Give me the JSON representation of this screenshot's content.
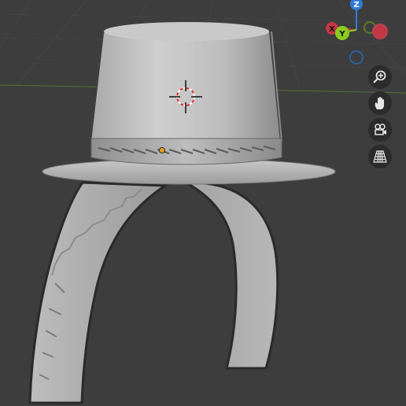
{
  "viewport": {
    "background": "#3d3d3d",
    "grid_color": "#444444",
    "horizon_color": "#5a6e3a",
    "object": "top-hat-on-arch-band"
  },
  "gizmo": {
    "z_label": "Z",
    "x_label": "X",
    "y_label": "Y",
    "colors": {
      "x": "#c33744",
      "y": "#8acb1f",
      "z": "#2f7bd7",
      "neg_x": "#b64452",
      "neg_y": "#5b7a2a",
      "neg_z": "#2f5e9c"
    }
  },
  "nav_buttons": [
    {
      "name": "zoom-icon"
    },
    {
      "name": "pan-hand-icon"
    },
    {
      "name": "camera-view-icon"
    },
    {
      "name": "perspective-grid-icon"
    }
  ]
}
